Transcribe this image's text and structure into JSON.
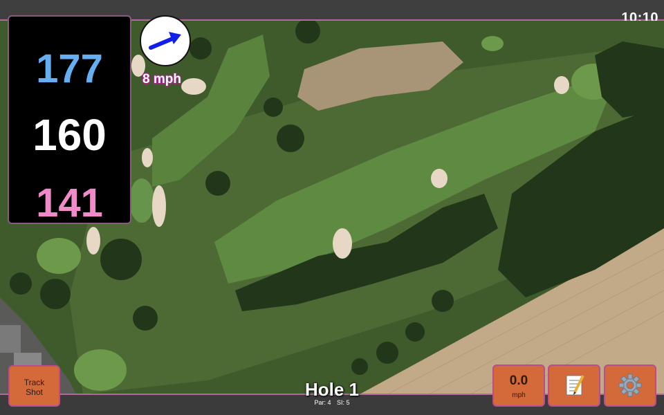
{
  "status": {
    "clock": "10:10"
  },
  "distances": {
    "back": "177",
    "middle": "160",
    "front": "141"
  },
  "wind": {
    "speed": "8 mph",
    "icon": "wind-direction-arrow-icon"
  },
  "hole": {
    "title": "Hole 1",
    "par": "Par: 4",
    "stroke_index": "SI: 5"
  },
  "buttons": {
    "track_shot": {
      "line1": "Track",
      "line2": "Shot"
    },
    "speed": {
      "value": "0.0",
      "unit": "mph"
    },
    "notes": {
      "icon": "notepad-icon"
    },
    "settings": {
      "icon": "gear-icon"
    }
  },
  "colors": {
    "back_distance": "#66aef2",
    "middle_distance": "#ffffff",
    "front_distance": "#f08ac8",
    "button_bg": "#d4693a",
    "accent_border": "#b06aa0"
  }
}
